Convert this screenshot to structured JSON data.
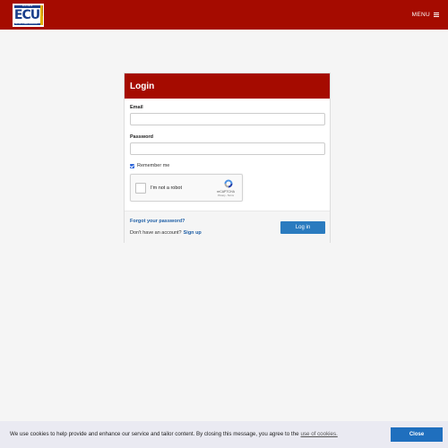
{
  "header": {
    "logo": {
      "text": "ECU",
      "top_strip": "AUSTRALIA",
      "bottom_strip": "EDITH COWAN UNIVERSITY",
      "side_strip": "UNIVERSITY"
    },
    "menu_label": "MENU",
    "background_color": "#a50b00"
  },
  "login": {
    "title": "Login",
    "email_label": "Email",
    "email_value": "",
    "password_label": "Password",
    "password_value": "",
    "remember_label": "Remember me",
    "remember_checked": true,
    "recaptcha": {
      "label": "I'm not a robot",
      "brand": "reCAPTCHA",
      "terms": "Privacy - Terms"
    },
    "forgot_label": "Forgot your password?",
    "no_account_text": "Don't have an account?",
    "signup_label": "Sign up",
    "submit_label": "Log in"
  },
  "cookie_bar": {
    "message": "We use cookies to help provide and enhance our service and tailor content. By closing this message, you agree to the",
    "link_label": "use of cookies.",
    "close_label": "Close"
  }
}
